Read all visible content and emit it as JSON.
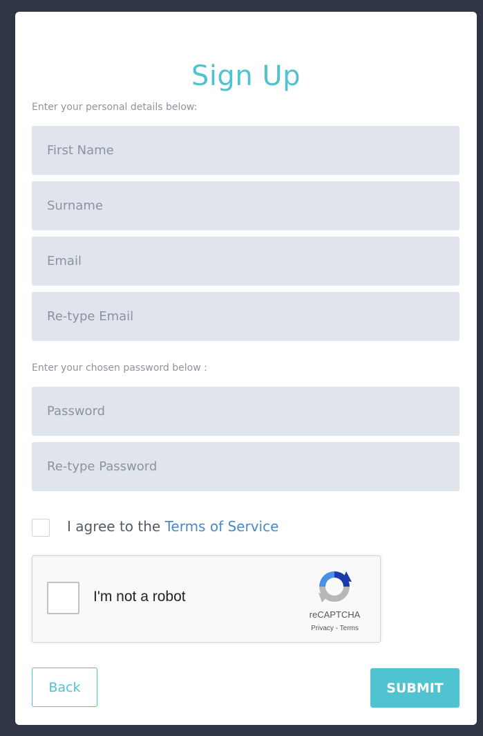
{
  "form": {
    "title": "Sign Up",
    "personal_label": "Enter your personal details below:",
    "password_label": "Enter your chosen password below :",
    "fields": {
      "first_name": "First Name",
      "surname": "Surname",
      "email": "Email",
      "retype_email": "Re-type Email",
      "password": "Password",
      "retype_password": "Re-type Password"
    },
    "agree": {
      "prefix": "I agree to the ",
      "link": "Terms of Service",
      "checked": false
    },
    "recaptcha": {
      "label": "I'm not a robot",
      "brand": "reCAPTCHA",
      "privacy": "Privacy",
      "separator": " - ",
      "terms": "Terms",
      "checked": false
    },
    "buttons": {
      "back": "Back",
      "submit": "SUBMIT"
    }
  },
  "colors": {
    "accent": "#4fc3cf",
    "background": "#2f3542",
    "field_bg": "#e0e4ec",
    "link": "#4a88c6"
  }
}
